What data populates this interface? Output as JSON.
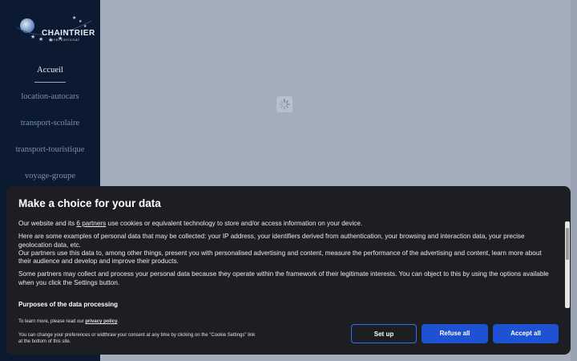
{
  "logo": {
    "name": "CHAINTRIER",
    "sub": "international"
  },
  "nav": [
    {
      "label": "Accueil",
      "active": true
    },
    {
      "label": "location-autocars"
    },
    {
      "label": "transport-scolaire"
    },
    {
      "label": "transport-touristique"
    },
    {
      "label": "voyage-groupe"
    }
  ],
  "cookie": {
    "title": "Make a choice for your data",
    "p1_pre": "Our website and its ",
    "p1_link": "6 partners",
    "p1_post": " use cookies or equivalent technology to store and/or access information on your device.",
    "p2": "Here are some examples of personal data that may be collected: your IP address, your identifiers derived from authentication, your browsing and interaction data, your precise geolocation data, etc.",
    "p3": "Our partners use this data to, among other things, present you with personalised advertising and content, measure the performance of the advertising and content, learn more about their audience and develop and improve their products.",
    "p4": "Some partners may collect and process your personal data because they operate within the framework of their legitimate interests. You can object to this by using the options available when you click the Settings button.",
    "purposes": "Purposes of the data processing",
    "learn_pre": "To learn more, please read our ",
    "learn_link": "privacy policy",
    "learn_post": ".",
    "change": "You can change your preferences or widthraw your consent at any time by clicking on the \"Cookie Settings\" link at the bottom of this site.",
    "buttons": {
      "setup": "Set up",
      "refuse": "Refuse all",
      "accept": "Accept all"
    }
  },
  "colors": {
    "sidebar": "#0b1a31",
    "accent": "#1f52d2",
    "banner": "#1d1e22"
  }
}
